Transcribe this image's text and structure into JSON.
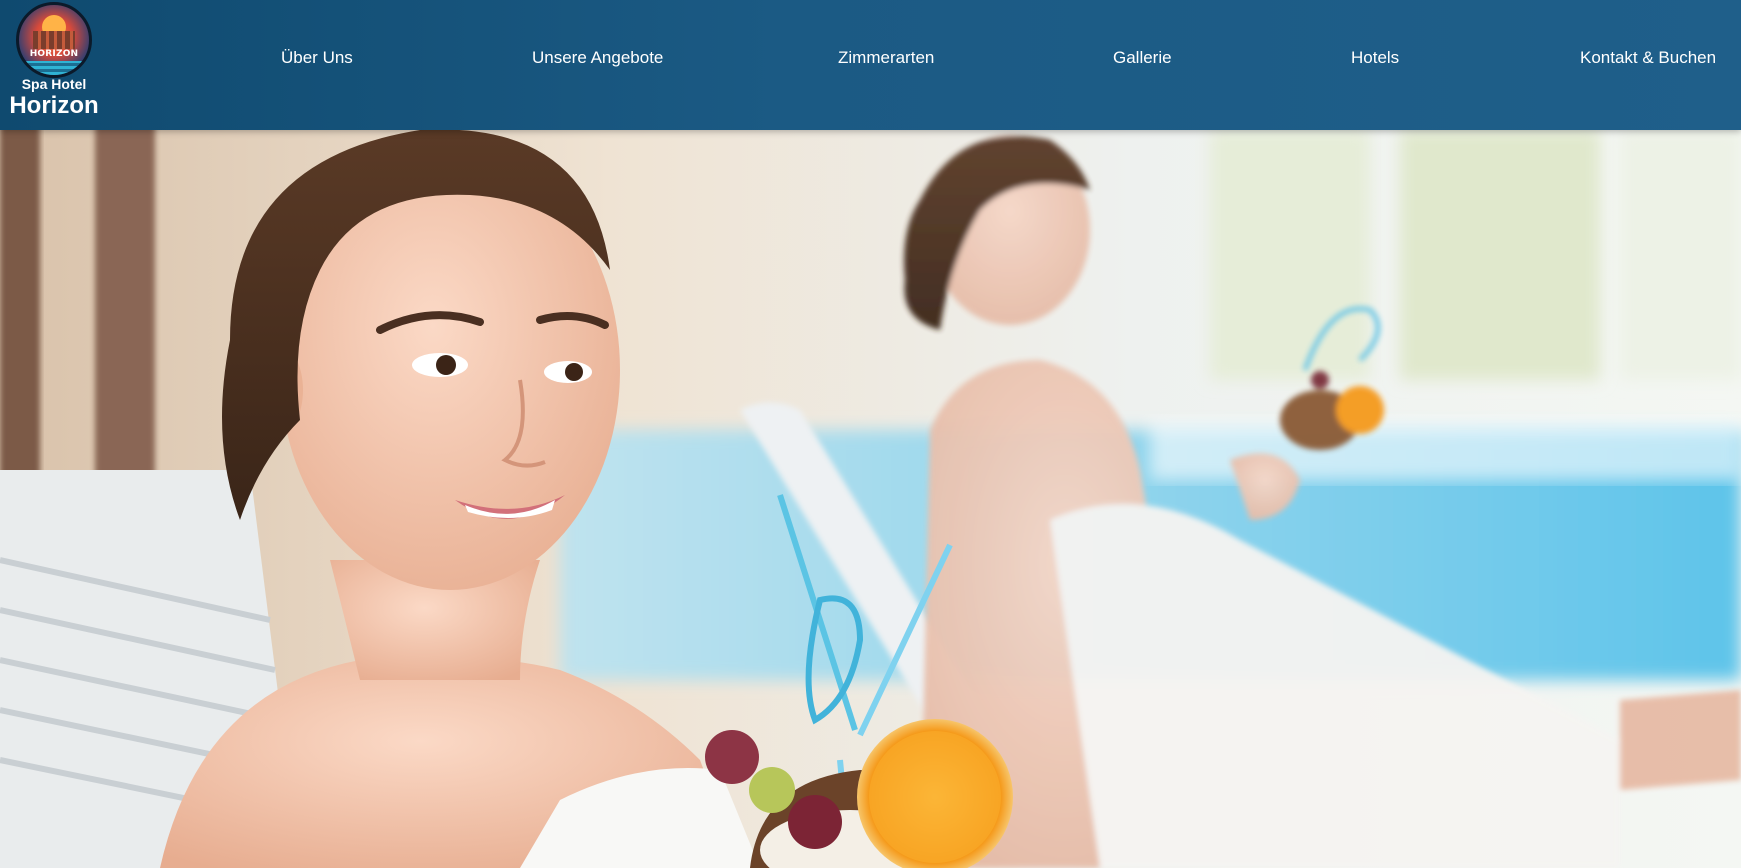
{
  "brand": {
    "badge_text": "HORIZON",
    "subtitle": "Spa Hotel",
    "name": "Horizon"
  },
  "nav": {
    "items": [
      {
        "label": "Über Uns"
      },
      {
        "label": "Unsere Angebote"
      },
      {
        "label": "Zimmerarten"
      },
      {
        "label": "Gallerie"
      },
      {
        "label": "Hotels"
      },
      {
        "label": "Kontakt & Buchen"
      }
    ]
  },
  "colors": {
    "header": "#1b5a84",
    "nav_text": "#ffffff"
  }
}
